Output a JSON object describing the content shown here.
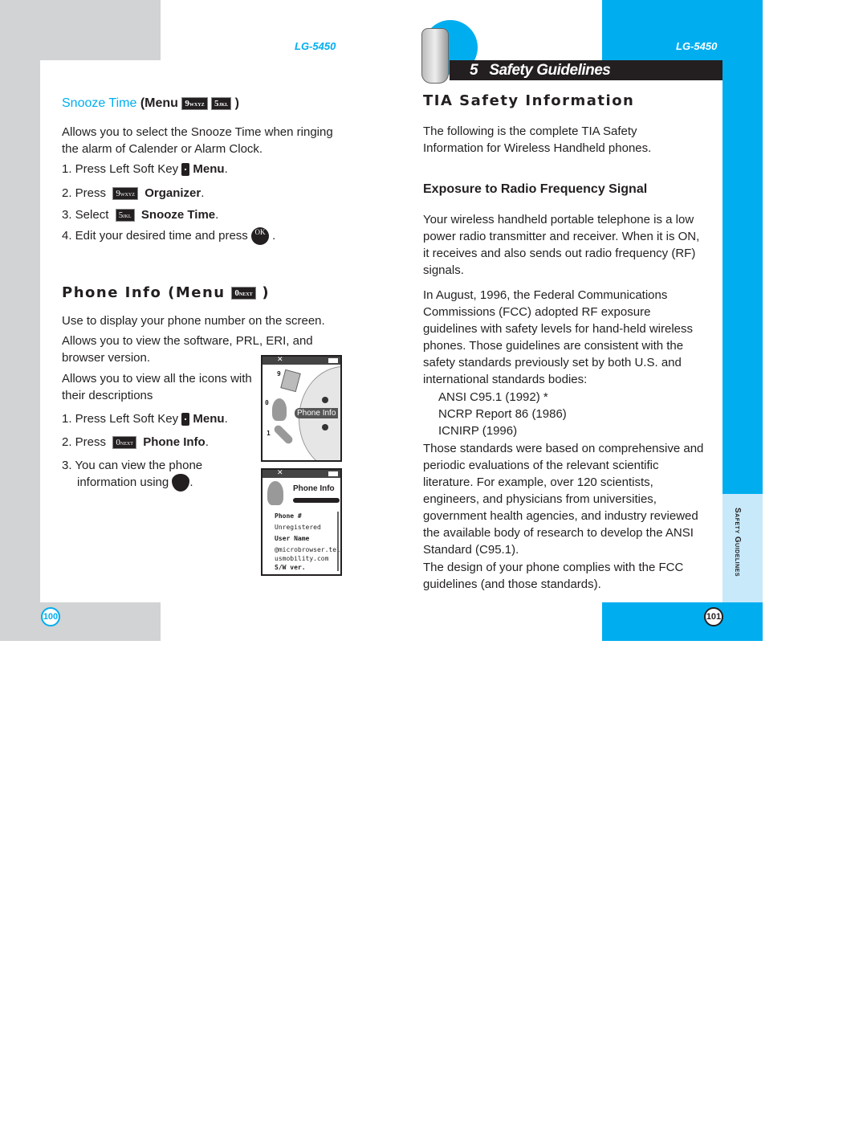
{
  "left": {
    "model": "LG-5450",
    "snooze": {
      "title": "Snooze Time",
      "menu_prefix": "(Menu",
      "key1": "9",
      "key1_sub": "WXYZ",
      "key2": "5",
      "key2_sub": "JKL",
      "close": ")",
      "desc": "Allows you to select the Snooze Time when ringing the alarm of Calender or Alarm Clock.",
      "step1": "1. Press Left Soft Key",
      "step1_bold": "Menu",
      "step2": "2. Press",
      "step2_bold": "Organizer",
      "step3": "3. Select",
      "step3_bold": "Snooze Time",
      "step4": "4. Edit your desired time and press",
      "ok": "OK"
    },
    "phoneinfo": {
      "title": "Phone Info (Menu",
      "key": "0",
      "key_sub": "NEXT",
      "close": ")",
      "desc1": "Use to display your phone number on the screen.",
      "desc2": "Allows you to view the software, PRL, ERI, and browser version.",
      "desc3": "Allows you to view all the icons with their descriptions",
      "step1": "1. Press Left Soft Key",
      "step1_bold": "Menu",
      "step2": "2. Press",
      "step2_bold": "Phone Info",
      "step3a": "3. You can view the phone",
      "step3b": "information using"
    },
    "screen1": {
      "label": "Phone Info",
      "n9": "9",
      "n0": "0",
      "n1": "1"
    },
    "screen2": {
      "title": "Phone Info",
      "rows": [
        {
          "t": "Phone #",
          "b": true
        },
        {
          "t": "Unregistered",
          "b": false
        },
        {
          "t": "User Name",
          "b": true
        },
        {
          "t": "@microbrowser.tel",
          "b": false
        },
        {
          "t": "usmobility.com",
          "b": false
        },
        {
          "t": "S/W ver.",
          "b": true
        }
      ]
    },
    "page": "100"
  },
  "right": {
    "model": "LG-5450",
    "chapter_num": "5",
    "chapter": "Safety Guidelines",
    "title": "TIA Safety Information",
    "intro": "The following is the complete TIA Safety Information for Wireless Handheld phones.",
    "subhead": "Exposure to Radio Frequency Signal",
    "para1": "Your wireless handheld portable telephone is a low power radio transmitter and receiver. When it is ON, it receives and also sends out radio frequency (RF) signals.",
    "para2": "In August, 1996, the Federal Communications Commissions (FCC) adopted RF exposure guidelines with safety levels for hand-held wireless phones. Those guidelines are consistent with the safety standards previously set by both U.S. and international standards bodies:",
    "standards": [
      "ANSI C95.1 (1992) *",
      "NCRP Report 86 (1986)",
      "ICNIRP (1996)"
    ],
    "para3": "Those standards were based on comprehensive and periodic evaluations of the relevant scientific literature. For example, over 120 scientists, engineers, and physicians from universities, government health agencies, and industry reviewed the available body of research to develop the ANSI Standard (C95.1).",
    "para4": "The design of your phone complies with the FCC guidelines (and those standards).",
    "side_tab": "Safety Guidelines",
    "page": "101"
  },
  "colors": {
    "accent": "#00aeef",
    "gray": "#d1d3d4",
    "light_blue": "#c7e9fa"
  }
}
